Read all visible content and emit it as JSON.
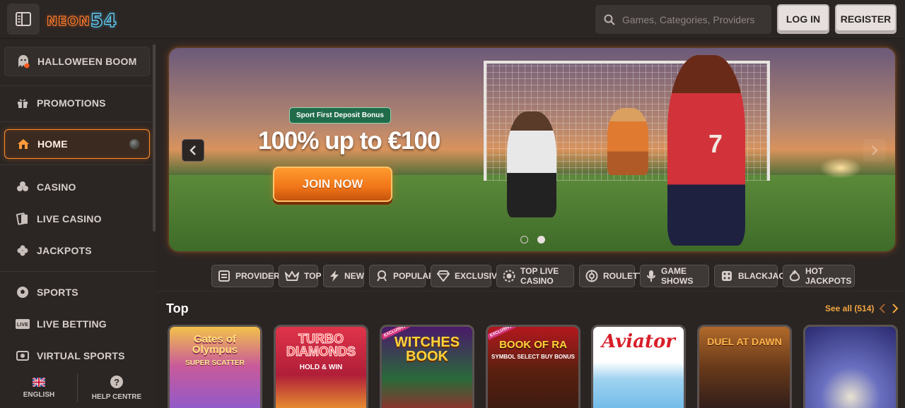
{
  "header": {
    "logo_text": "NEON",
    "logo_num": "54",
    "search_placeholder": "Games, Categories, Providers",
    "login_label": "LOG IN",
    "register_label": "REGISTER"
  },
  "sidebar": {
    "halloween": "HALLOWEEN BOOM",
    "items": [
      {
        "label": "PROMOTIONS",
        "icon": "gift-icon"
      },
      {
        "label": "HOME",
        "icon": "home-icon"
      },
      {
        "label": "CASINO",
        "icon": "cards-icon"
      },
      {
        "label": "LIVE CASINO",
        "icon": "live-cards-icon"
      },
      {
        "label": "JACKPOTS",
        "icon": "clover-icon"
      },
      {
        "label": "SPORTS",
        "icon": "soccer-ball-icon"
      },
      {
        "label": "LIVE BETTING",
        "icon": "live-icon"
      },
      {
        "label": "VIRTUAL SPORTS",
        "icon": "virtual-icon"
      }
    ],
    "language": "ENGLISH",
    "help": "HELP CENTRE"
  },
  "banner": {
    "tag": "Sport First Deposit Bonus",
    "title": "100% up to €100",
    "cta": "JOIN NOW",
    "player_number": "7"
  },
  "categories": [
    {
      "label": "PROVIDERS",
      "icon": "providers-icon"
    },
    {
      "label": "TOP",
      "icon": "crown-icon"
    },
    {
      "label": "NEW",
      "icon": "bolt-icon"
    },
    {
      "label": "POPULAR",
      "icon": "popular-icon"
    },
    {
      "label": "EXCLUSIVE",
      "icon": "diamond-icon"
    },
    {
      "label": "TOP LIVE CASINO",
      "icon": "chip-icon"
    },
    {
      "label": "ROULETTE",
      "icon": "roulette-icon"
    },
    {
      "label": "GAME SHOWS",
      "icon": "microphone-icon"
    },
    {
      "label": "BLACKJACK",
      "icon": "dice-icon"
    },
    {
      "label": "HOT JACKPOTS",
      "icon": "flame-icon"
    }
  ],
  "section": {
    "title": "Top",
    "see_all": "See all (514)"
  },
  "games": [
    {
      "title": "Gates of Olympus",
      "sub": "SUPER SCATTER"
    },
    {
      "title": "TURBO DIAMONDS",
      "sub": "HOLD & WIN"
    },
    {
      "title": "WITCHES BOOK",
      "sub": "",
      "badge": "EXCLUSIVE"
    },
    {
      "title": "BOOK OF RA",
      "sub": "SYMBOL SELECT BUY BONUS",
      "badge": "EXCLUSIVE"
    },
    {
      "title": "Aviator",
      "sub": ""
    },
    {
      "title": "DUEL AT DAWN",
      "sub": ""
    },
    {
      "title": "",
      "sub": ""
    }
  ]
}
